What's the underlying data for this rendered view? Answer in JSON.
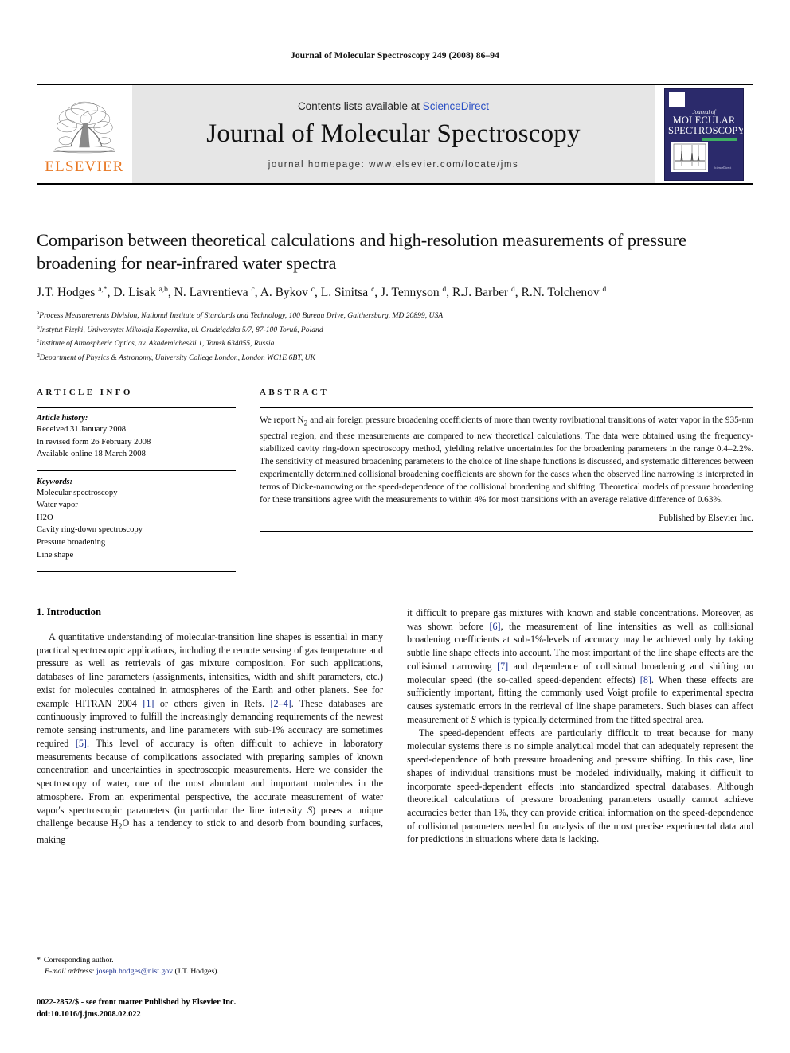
{
  "running_head": "Journal of Molecular Spectroscopy 249 (2008) 86–94",
  "masthead": {
    "contents_prefix": "Contents lists available at ",
    "sciencedirect": "ScienceDirect",
    "journal_name": "Journal of Molecular Spectroscopy",
    "homepage": "journal homepage: www.elsevier.com/locate/jms",
    "publisher_wordmark": "ELSEVIER",
    "cover": {
      "kicker": "Journal of",
      "title_line1": "MOLECULAR",
      "title_line2": "SPECTROSCOPY",
      "badge": "ScienceDirect",
      "accent_color": "#3fae63",
      "background_color": "#2b2a6b"
    },
    "sciencedirect_color": "#2A4FC4",
    "elsevier_orange": "#E87722",
    "band_color": "#e6e6e6"
  },
  "article": {
    "title": "Comparison between theoretical calculations and high-resolution measurements of pressure broadening for near-infrared water spectra",
    "authors_html": "J.T. Hodges <sup>a,*</sup>, D. Lisak <sup>a,b</sup>, N. Lavrentieva <sup>c</sup>, A. Bykov <sup>c</sup>, L. Sinitsa <sup>c</sup>, J. Tennyson <sup>d</sup>, R.J. Barber <sup>d</sup>, R.N. Tolchenov <sup>d</sup>",
    "affiliations": [
      {
        "marker": "a",
        "text": "Process Measurements Division, National Institute of Standards and Technology, 100 Bureau Drive, Gaithersburg, MD 20899, USA"
      },
      {
        "marker": "b",
        "text": "Instytut Fizyki, Uniwersytet Mikołaja Kopernika, ul. Grudziądzka 5/7, 87-100 Toruń, Poland"
      },
      {
        "marker": "c",
        "text": "Institute of Atmospheric Optics, av. Akademicheskii 1, Tomsk 634055, Russia"
      },
      {
        "marker": "d",
        "text": "Department of Physics & Astronomy, University College London, London WC1E 6BT, UK"
      }
    ]
  },
  "article_info": {
    "label": "ARTICLE INFO",
    "history_heading": "Article history:",
    "history": [
      "Received 31 January 2008",
      "In revised form 26 February 2008",
      "Available online 18 March 2008"
    ],
    "keywords_heading": "Keywords:",
    "keywords": [
      "Molecular spectroscopy",
      "Water vapor",
      "H2O",
      "Cavity ring-down spectroscopy",
      "Pressure broadening",
      "Line shape"
    ]
  },
  "abstract": {
    "label": "ABSTRACT",
    "text_html": "We report N<sub>2</sub> and air foreign pressure broadening coefficients of more than twenty rovibrational transitions of water vapor in the 935-nm spectral region, and these measurements are compared to new theoretical calculations. The data were obtained using the frequency-stabilized cavity ring-down spectroscopy method, yielding relative uncertainties for the broadening parameters in the range 0.4–2.2%. The sensitivity of measured broadening parameters to the choice of line shape functions is discussed, and systematic differences between experimentally determined collisional broadening coefficients are shown for the cases when the observed line narrowing is interpreted in terms of Dicke-narrowing or the speed-dependence of the collisional broadening and shifting. Theoretical models of pressure broadening for these transitions agree with the measurements to within 4% for most transitions with an average relative difference of 0.63%.",
    "published_by": "Published by Elsevier Inc."
  },
  "body": {
    "section_title": "1. Introduction",
    "left_paragraphs_html": [
      "A quantitative understanding of molecular-transition line shapes is essential in many practical spectroscopic applications, including the remote sensing of gas temperature and pressure as well as retrievals of gas mixture composition. For such applications, databases of line parameters (assignments, intensities, width and shift parameters, etc.) exist for molecules contained in atmospheres of the Earth and other planets. See for example HITRAN 2004 <span class=\"ref\">[1]</span> or others given in Refs. <span class=\"ref\">[2–4]</span>. These databases are continuously improved to fulfill the increasingly demanding requirements of the newest remote sensing instruments, and line parameters with sub-1% accuracy are sometimes required <span class=\"ref\">[5]</span>. This level of accuracy is often difficult to achieve in laboratory measurements because of complications associated with preparing samples of known concentration and uncertainties in spectroscopic measurements. Here we consider the spectroscopy of water, one of the most abundant and important molecules in the atmosphere. From an experimental perspective, the accurate measurement of water vapor's spectroscopic parameters (in particular the line intensity <i>S</i>) poses a unique challenge because H<sub>2</sub>O has a tendency to stick to and desorb from bounding surfaces, making"
    ],
    "right_paragraphs_html": [
      "it difficult to prepare gas mixtures with known and stable concentrations. Moreover, as was shown before <span class=\"ref\">[6]</span>, the measurement of line intensities as well as collisional broadening coefficients at sub-1%-levels of accuracy may be achieved only by taking subtle line shape effects into account. The most important of the line shape effects are the collisional narrowing <span class=\"ref\">[7]</span> and dependence of collisional broadening and shifting on molecular speed (the so-called speed-dependent effects) <span class=\"ref\">[8]</span>. When these effects are sufficiently important, fitting the commonly used Voigt profile to experimental spectra causes systematic errors in the retrieval of line shape parameters. Such biases can affect measurement of <i>S</i> which is typically determined from the fitted spectral area.",
      "The speed-dependent effects are particularly difficult to treat because for many molecular systems there is no simple analytical model that can adequately represent the speed-dependence of both pressure broadening and pressure shifting. In this case, line shapes of individual transitions must be modeled individually, making it difficult to incorporate speed-dependent effects into standardized spectral databases. Although theoretical calculations of pressure broadening parameters usually cannot achieve accuracies better than 1%, they can provide critical information on the speed-dependence of collisional parameters needed for analysis of the most precise experimental data and for predictions in situations where data is lacking."
    ]
  },
  "footnote": {
    "corresponding": "Corresponding author.",
    "email_label": "E-mail address:",
    "email": "joseph.hodges@nist.gov",
    "email_owner": "(J.T. Hodges).",
    "link_color": "#1a2f8f"
  },
  "footer": {
    "issn_line": "0022-2852/$ - see front matter Published by Elsevier Inc.",
    "doi_line": "doi:10.1016/j.jms.2008.02.022"
  }
}
